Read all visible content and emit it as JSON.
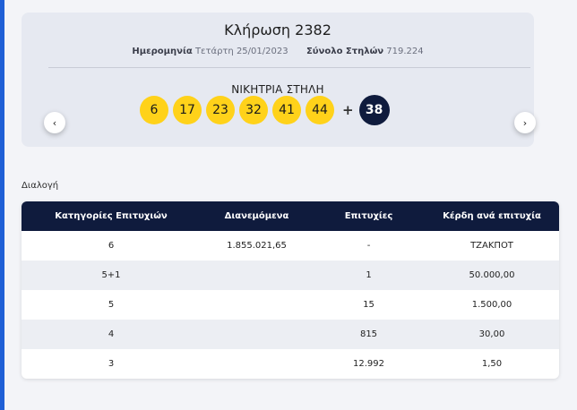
{
  "draw": {
    "title": "Κλήρωση 2382",
    "date_label": "Ημερομηνία",
    "date_value": "Τετάρτη 25/01/2023",
    "columns_label": "Σύνολο Στηλών",
    "columns_value": "719.224",
    "winning_label": "ΝΙΚΗΤΡΙΑ ΣΤΗΛΗ",
    "numbers": [
      "6",
      "17",
      "23",
      "32",
      "41",
      "44"
    ],
    "plus": "+",
    "joker": "38",
    "prev_icon": "‹",
    "next_icon": "›"
  },
  "distribution": {
    "label": "Διαλογή",
    "headers": [
      "Κατηγορίες Επιτυχιών",
      "Διανεμόμενα",
      "Επιτυχίες",
      "Κέρδη ανά επιτυχία"
    ],
    "rows": [
      [
        "6",
        "1.855.021,65",
        "-",
        "ΤΖΑΚΠΟΤ"
      ],
      [
        "5+1",
        "",
        "1",
        "50.000,00"
      ],
      [
        "5",
        "",
        "15",
        "1.500,00"
      ],
      [
        "4",
        "",
        "815",
        "30,00"
      ],
      [
        "3",
        "",
        "12.992",
        "1,50"
      ]
    ]
  },
  "colors": {
    "ball": "#ffd21a",
    "joker": "#0f1b3d",
    "table_header": "#0f1b3d",
    "accent_edge": "#1f5fd6"
  },
  "icons": {
    "prev": "chevron-left-icon",
    "next": "chevron-right-icon"
  }
}
